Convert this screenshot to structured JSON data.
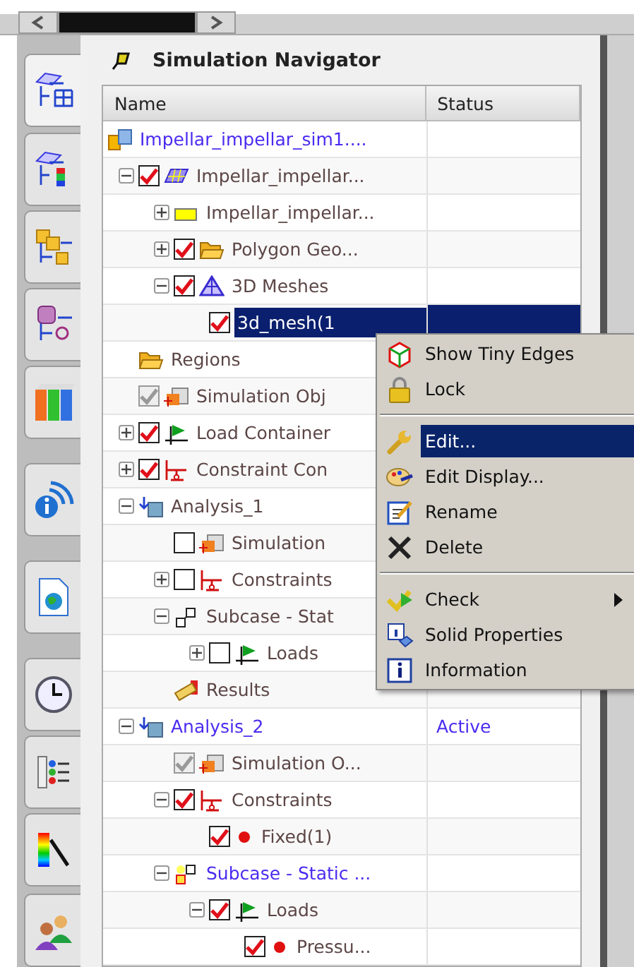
{
  "side_tabs": [
    {
      "kind": "fem-navigator",
      "selected": true
    },
    {
      "kind": "post-navigator",
      "selected": false
    },
    {
      "kind": "assembly-navigator",
      "selected": false
    },
    {
      "kind": "part-navigator",
      "selected": false
    },
    {
      "kind": "books",
      "selected": false
    },
    {
      "kind": "info",
      "selected": false
    },
    {
      "kind": "web",
      "selected": false
    },
    {
      "kind": "clock",
      "selected": false
    },
    {
      "kind": "palette",
      "selected": false
    },
    {
      "kind": "color-bar",
      "selected": false
    },
    {
      "kind": "users",
      "selected": false
    }
  ],
  "navigator": {
    "title": "Simulation Navigator",
    "columns": [
      "Name",
      "Status"
    ],
    "tree": [
      {
        "label": "Impellar_impellar_sim1....",
        "kind": "sim-file",
        "active": true,
        "selected": false,
        "children": [
          {
            "label": "Impellar_impellar...",
            "kind": "fem",
            "expanded": true,
            "checkbox": {
              "checked": true,
              "disabled": false
            },
            "active": false,
            "selected": false,
            "children": [
              {
                "label": "Impellar_impellar...",
                "kind": "part",
                "expanded": false,
                "active": false,
                "selected": false
              },
              {
                "label": "Polygon Geo...",
                "kind": "folder",
                "expanded": false,
                "checkbox": {
                  "checked": true,
                  "disabled": false
                },
                "active": false,
                "selected": false
              },
              {
                "label": "3D Meshes",
                "kind": "mesh",
                "expanded": true,
                "checkbox": {
                  "checked": true,
                  "disabled": false
                },
                "active": false,
                "selected": false,
                "children": [
                  {
                    "label": "3d_mesh(1",
                    "kind": "plain",
                    "checkbox": {
                      "checked": true,
                      "disabled": false
                    },
                    "active": false,
                    "selected": true
                  }
                ]
              }
            ]
          },
          {
            "label": "Regions",
            "kind": "folder",
            "active": false,
            "selected": false
          },
          {
            "label": "Simulation Obj",
            "kind": "sim-object",
            "checkbox": {
              "checked": true,
              "disabled": true
            },
            "active": false,
            "selected": false
          },
          {
            "label": "Load Container",
            "kind": "load",
            "expanded": false,
            "checkbox": {
              "checked": true,
              "disabled": false
            },
            "active": false,
            "selected": false
          },
          {
            "label": "Constraint Con",
            "kind": "constraint",
            "expanded": false,
            "checkbox": {
              "checked": true,
              "disabled": false
            },
            "active": false,
            "selected": false
          },
          {
            "label": "Analysis_1",
            "kind": "solution",
            "expanded": true,
            "active": false,
            "selected": false,
            "children": [
              {
                "label": "Simulation",
                "kind": "sim-object",
                "checkbox": {
                  "checked": false,
                  "disabled": false
                },
                "active": false,
                "selected": false
              },
              {
                "label": "Constraints",
                "kind": "constraint",
                "expanded": false,
                "checkbox": {
                  "checked": false,
                  "disabled": false
                },
                "active": false,
                "selected": false
              },
              {
                "label": "Subcase - Stat",
                "kind": "subcase",
                "expanded": true,
                "active": false,
                "selected": false,
                "children": [
                  {
                    "label": "Loads",
                    "kind": "load",
                    "expanded": false,
                    "checkbox": {
                      "checked": false,
                      "disabled": false
                    },
                    "active": false,
                    "selected": false
                  }
                ]
              },
              {
                "label": "Results",
                "kind": "results",
                "active": false,
                "selected": false
              }
            ]
          },
          {
            "label": "Analysis_2",
            "kind": "solution",
            "expanded": true,
            "active": true,
            "selected": false,
            "status": "Active",
            "children": [
              {
                "label": "Simulation O...",
                "kind": "sim-object",
                "checkbox": {
                  "checked": true,
                  "disabled": true
                },
                "active": false,
                "selected": false
              },
              {
                "label": "Constraints",
                "kind": "constraint",
                "expanded": true,
                "checkbox": {
                  "checked": true,
                  "disabled": false
                },
                "active": false,
                "selected": false,
                "children": [
                  {
                    "label": "Fixed(1)",
                    "kind": "dot",
                    "checkbox": {
                      "checked": true,
                      "disabled": false
                    },
                    "active": false,
                    "selected": false
                  }
                ]
              },
              {
                "label": "Subcase - Static ...",
                "kind": "subcase-active",
                "expanded": true,
                "active": true,
                "selected": false,
                "children": [
                  {
                    "label": "Loads",
                    "kind": "load",
                    "expanded": true,
                    "checkbox": {
                      "checked": true,
                      "disabled": false
                    },
                    "active": false,
                    "selected": false,
                    "children": [
                      {
                        "label": "Pressu...",
                        "kind": "dot",
                        "checkbox": {
                          "checked": true,
                          "disabled": false
                        },
                        "active": false,
                        "selected": false
                      }
                    ]
                  }
                ]
              }
            ]
          }
        ]
      }
    ]
  },
  "context_menu": {
    "items": [
      {
        "kind": "tiny-edges",
        "label": "Show Tiny Edges",
        "selected": false,
        "submenu": false
      },
      {
        "kind": "lock",
        "label": "Lock",
        "selected": false,
        "submenu": false
      },
      {
        "kind": "separator"
      },
      {
        "kind": "wrench",
        "label": "Edit...",
        "selected": true,
        "submenu": false
      },
      {
        "kind": "display",
        "label": "Edit Display...",
        "selected": false,
        "submenu": false
      },
      {
        "kind": "rename",
        "label": "Rename",
        "selected": false,
        "submenu": false
      },
      {
        "kind": "delete",
        "label": "Delete",
        "selected": false,
        "submenu": false
      },
      {
        "kind": "separator"
      },
      {
        "kind": "check",
        "label": "Check",
        "selected": false,
        "submenu": true
      },
      {
        "kind": "properties",
        "label": "Solid Properties",
        "selected": false,
        "submenu": false
      },
      {
        "kind": "info",
        "label": "Information",
        "selected": false,
        "submenu": false
      }
    ]
  }
}
